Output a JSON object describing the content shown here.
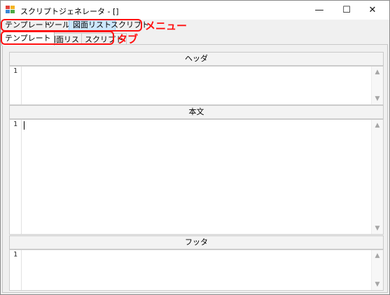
{
  "window": {
    "title": "スクリプトジェネレータ - []",
    "controls": {
      "minimize": "—",
      "maximize": "☐",
      "close": "✕"
    }
  },
  "menu": {
    "items": [
      {
        "label": "テンプレート"
      },
      {
        "label": "ツール"
      },
      {
        "label": "図面リスト",
        "selected": true
      },
      {
        "label": "スクリプト"
      }
    ]
  },
  "tabs": {
    "items": [
      {
        "label": "テンプレート",
        "active": true
      },
      {
        "label": "図面リスト"
      },
      {
        "label": "スクリプト"
      }
    ]
  },
  "sections": {
    "header": {
      "title": "ヘッダ",
      "first_line": "1"
    },
    "body": {
      "title": "本文",
      "first_line": "1"
    },
    "footer": {
      "title": "フッタ",
      "first_line": "1"
    }
  },
  "annotations": {
    "menu_label": "メニュー",
    "tab_label": "タブ",
    "color": "#ff1010"
  },
  "scroll": {
    "up_arrow": "▲",
    "down_arrow": "▼"
  }
}
